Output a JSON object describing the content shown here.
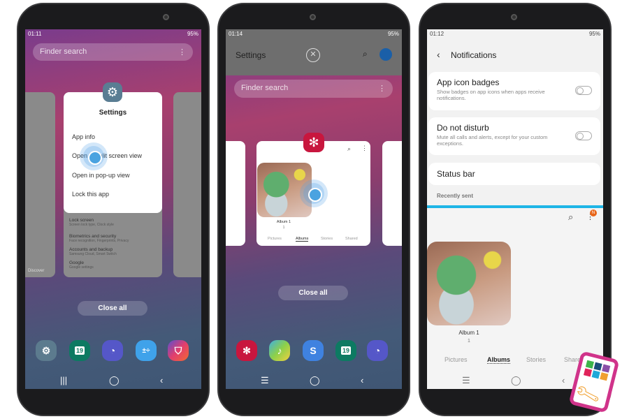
{
  "phone1": {
    "status": {
      "time": "01:11",
      "right": "95%"
    },
    "search": {
      "placeholder": "Finder search"
    },
    "popup": {
      "app_name": "Settings",
      "items": [
        "App info",
        "Open in split screen view",
        "Open in pop-up view",
        "Lock this app"
      ]
    },
    "bg_items": [
      {
        "title": "Lock screen",
        "sub": "Screen lock type, Clock style"
      },
      {
        "title": "Biometrics and security",
        "sub": "Face recognition, Fingerprints, Privacy"
      },
      {
        "title": "Accounts and backup",
        "sub": "Samsung Cloud, Smart Switch"
      },
      {
        "title": "Google",
        "sub": "Google settings"
      }
    ],
    "left_card_label": "Discover",
    "close_all": "Close all",
    "dock": [
      "settings-icon",
      "calendar-icon",
      "clock-icon",
      "calculator-icon",
      "store-icon"
    ],
    "calendar_day": "19"
  },
  "phone2": {
    "status": {
      "time": "01:14",
      "right": "95%"
    },
    "top_app": {
      "title": "Settings"
    },
    "search": {
      "placeholder": "Finder search"
    },
    "card": {
      "album": "Album 1",
      "count": "1",
      "tabs": [
        "Pictures",
        "Albums",
        "Stories",
        "Shared"
      ],
      "active_tab": "Albums"
    },
    "close_all": "Close all",
    "dock": [
      "gallery-icon",
      "sketch-icon",
      "link-icon",
      "calendar-icon",
      "clock-icon"
    ],
    "calendar_day": "19"
  },
  "phone3": {
    "status": {
      "time": "01:12",
      "right": "95%"
    },
    "header": {
      "title": "Notifications"
    },
    "settings": [
      {
        "title": "App icon badges",
        "sub": "Show badges on app icons when apps receive notifications.",
        "toggle": false
      },
      {
        "title": "Do not disturb",
        "sub": "Mute all calls and alerts, except for your custom exceptions.",
        "toggle": false
      },
      {
        "title": "Status bar"
      }
    ],
    "section": "Recently sent",
    "gallery": {
      "badge": "N",
      "album": "Album 1",
      "count": "1",
      "tabs": [
        "Pictures",
        "Albums",
        "Stories",
        "Shared"
      ],
      "active_tab": "Albums"
    }
  },
  "colors": {
    "accent": "#4aa3e0",
    "divider": "#1fb5e6",
    "gallery_red": "#c8163e"
  }
}
